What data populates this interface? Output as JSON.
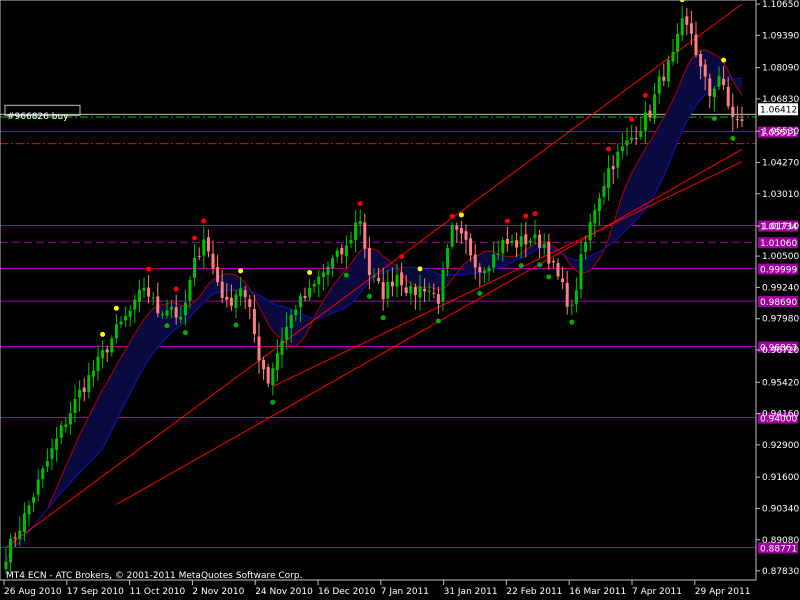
{
  "chart_data": {
    "type": "candlestick",
    "platform_label": "MT4 ECN - ATC Brokers, © 2001-2011 MetaQuotes Software Corp.",
    "order_label": "#966826 buy",
    "ylim": [
      0.875,
      1.1065
    ],
    "y_ticks": [
      "1.10650",
      "1.09390",
      "1.08090",
      "1.06830",
      "1.05530",
      "1.04270",
      "1.03010",
      "1.01710",
      "1.00500",
      "0.99240",
      "0.97980",
      "0.96720",
      "0.95420",
      "0.94160",
      "0.92900",
      "0.91600",
      "0.90340",
      "0.89080",
      "0.87830"
    ],
    "x_ticks": [
      "26 Aug 2010",
      "17 Sep 2010",
      "11 Oct 2010",
      "2 Nov 2010",
      "24 Nov 2010",
      "16 Dec 2010",
      "7 Jan 2011",
      "31 Jan 2011",
      "22 Feb 2011",
      "16 Mar 2011",
      "7 Apr 2011",
      "29 Apr 2011"
    ],
    "current_price": "1.06412",
    "horizontal_levels": [
      {
        "label": "1.05511",
        "price": 1.0551,
        "style": "solid"
      },
      {
        "label": "1.01734",
        "price": 1.0173,
        "style": "solid"
      },
      {
        "label": "1.01060",
        "price": 1.0106,
        "style": "dashed"
      },
      {
        "label": "0.99999",
        "price": 1.0,
        "style": "solid"
      },
      {
        "label": "0.98690",
        "price": 0.9869,
        "style": "solid"
      },
      {
        "label": "0.96863",
        "price": 0.9686,
        "style": "solid"
      },
      {
        "label": "0.94000",
        "price": 0.94,
        "style": "solid"
      },
      {
        "label": "0.88771",
        "price": 0.8877,
        "style": "solid"
      }
    ],
    "order_lines": {
      "open": 1.0641,
      "take_profit": 1.061,
      "stop_loss": 1.0503
    },
    "trendlines": [
      {
        "x": [
          0,
          160
        ],
        "y": [
          0.8877,
          1.1065
        ]
      },
      {
        "x": [
          58,
          160
        ],
        "y": [
          0.9525,
          1.043
        ]
      },
      {
        "x": [
          24,
          160
        ],
        "y": [
          0.905,
          1.048
        ]
      }
    ],
    "key_points": [
      [
        0,
        0.885
      ],
      [
        4,
        0.9
      ],
      [
        8,
        0.918
      ],
      [
        12,
        0.935
      ],
      [
        16,
        0.95
      ],
      [
        20,
        0.962
      ],
      [
        24,
        0.975
      ],
      [
        28,
        0.985
      ],
      [
        30,
        0.993
      ],
      [
        33,
        0.983
      ],
      [
        36,
        0.985
      ],
      [
        38,
        0.978
      ],
      [
        41,
        1.002
      ],
      [
        43,
        1.013
      ],
      [
        45,
        1.0
      ],
      [
        48,
        0.985
      ],
      [
        51,
        0.993
      ],
      [
        53,
        0.982
      ],
      [
        55,
        0.965
      ],
      [
        57,
        0.955
      ],
      [
        60,
        0.972
      ],
      [
        63,
        0.985
      ],
      [
        66,
        0.99
      ],
      [
        68,
        0.996
      ],
      [
        71,
        1.003
      ],
      [
        74,
        1.008
      ],
      [
        76,
        1.018
      ],
      [
        77,
        1.02
      ],
      [
        79,
        0.998
      ],
      [
        82,
        0.99
      ],
      [
        85,
        0.998
      ],
      [
        88,
        0.99
      ],
      [
        91,
        0.993
      ],
      [
        94,
        0.988
      ],
      [
        97,
        1.015
      ],
      [
        100,
        1.01
      ],
      [
        103,
        1.0
      ],
      [
        106,
        1.005
      ],
      [
        108,
        1.01
      ],
      [
        111,
        1.01
      ],
      [
        114,
        1.012
      ],
      [
        117,
        1.01
      ],
      [
        119,
        1.0
      ],
      [
        121,
        0.992
      ],
      [
        123,
        0.983
      ],
      [
        125,
        1.003
      ],
      [
        128,
        1.025
      ],
      [
        131,
        1.04
      ],
      [
        134,
        1.048
      ],
      [
        137,
        1.055
      ],
      [
        140,
        1.063
      ],
      [
        142,
        1.075
      ],
      [
        145,
        1.085
      ],
      [
        147,
        1.098
      ],
      [
        149,
        1.095
      ],
      [
        151,
        1.08
      ],
      [
        153,
        1.07
      ],
      [
        155,
        1.078
      ],
      [
        157,
        1.065
      ],
      [
        159,
        1.059
      ],
      [
        160,
        1.058
      ]
    ],
    "dot_colors": {
      "up": "#ff0000",
      "mid": "#ffff00",
      "down": "#00b000"
    },
    "colors": {
      "bull": "#00c000",
      "bear": "#ff8080",
      "level": "#a000a0",
      "trend": "#ff0000",
      "ma_red": "#b00000",
      "ma_blue": "#1010c0",
      "take_profit": "#00c000",
      "stop_loss": "#ff0000",
      "bid": "#c0c0c0"
    }
  }
}
